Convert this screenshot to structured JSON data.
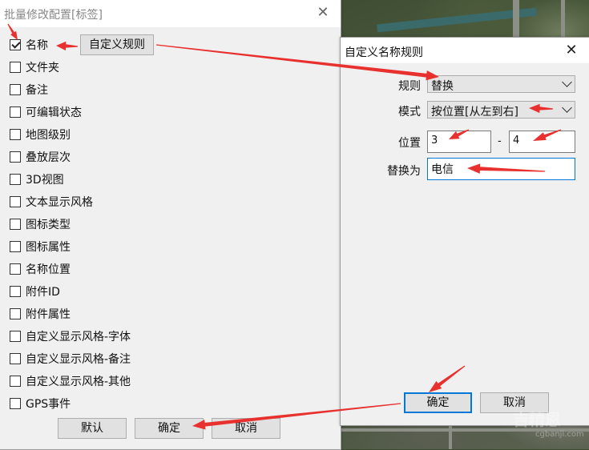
{
  "left_dialog": {
    "title": "批量修改配置[标签]",
    "close_glyph": "✕",
    "custom_rule_button": "自定义规则",
    "items": [
      {
        "label": "名称",
        "checked": true
      },
      {
        "label": "文件夹",
        "checked": false
      },
      {
        "label": "备注",
        "checked": false
      },
      {
        "label": "可编辑状态",
        "checked": false
      },
      {
        "label": "地图级别",
        "checked": false
      },
      {
        "label": "叠放层次",
        "checked": false
      },
      {
        "label": "3D视图",
        "checked": false
      },
      {
        "label": "文本显示风格",
        "checked": false
      },
      {
        "label": "图标类型",
        "checked": false
      },
      {
        "label": "图标属性",
        "checked": false
      },
      {
        "label": "名称位置",
        "checked": false
      },
      {
        "label": "附件ID",
        "checked": false
      },
      {
        "label": "附件属性",
        "checked": false
      },
      {
        "label": "自定义显示风格-字体",
        "checked": false
      },
      {
        "label": "自定义显示风格-备注",
        "checked": false
      },
      {
        "label": "自定义显示风格-其他",
        "checked": false
      },
      {
        "label": "GPS事件",
        "checked": false
      }
    ],
    "buttons": {
      "default": "默认",
      "ok": "确定",
      "cancel": "取消"
    }
  },
  "right_dialog": {
    "title": "自定义名称规则",
    "close_glyph": "✕",
    "rule_label": "规则",
    "rule_value": "替换",
    "mode_label": "模式",
    "mode_value": "按位置[从左到右]",
    "position_label": "位置",
    "position_from": "3",
    "position_sep": "-",
    "position_to": "4",
    "replace_label": "替换为",
    "replace_value": "电信",
    "buttons": {
      "ok": "确定",
      "cancel": "取消"
    }
  },
  "annotation_color": "#e8312f",
  "watermark": {
    "main": "吉精恩",
    "sub": "cgbanji.com"
  }
}
